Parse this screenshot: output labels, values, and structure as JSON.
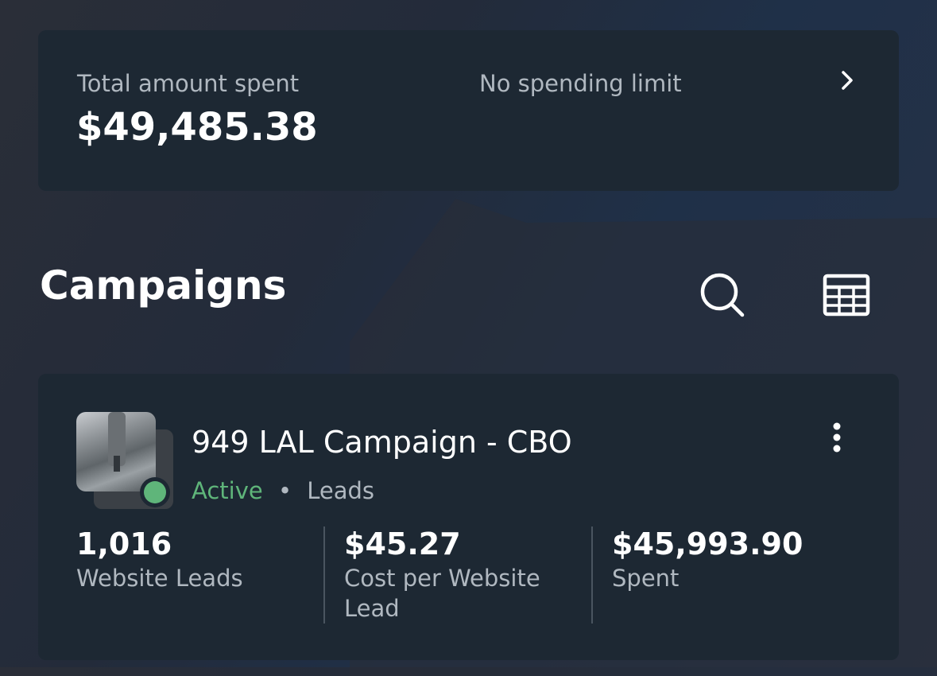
{
  "summary": {
    "total_label": "Total amount spent",
    "total_amount": "$49,485.38",
    "limit_label": "No spending limit"
  },
  "campaigns_section": {
    "title": "Campaigns",
    "search_icon": "search-icon",
    "table_icon": "table-view-icon"
  },
  "campaign": {
    "name": "949 LAL Campaign - CBO",
    "status": "Active",
    "separator": "•",
    "objective": "Leads",
    "status_color": "#5fb57a",
    "metrics": [
      {
        "value": "1,016",
        "label": "Website Leads"
      },
      {
        "value": "$45.27",
        "label": "Cost per Website Lead"
      },
      {
        "value": "$45,993.90",
        "label": "Spent"
      }
    ]
  },
  "icons": {
    "chevron": "chevron-right-icon",
    "more": "more-vertical-icon"
  }
}
